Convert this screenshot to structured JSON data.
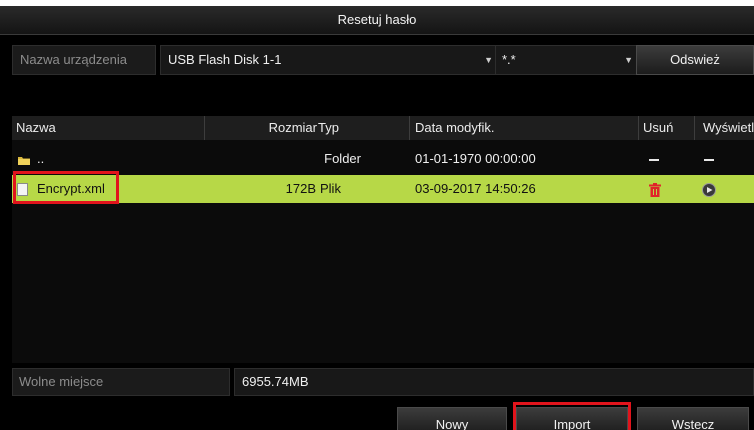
{
  "window": {
    "title": "Resetuj hasło"
  },
  "device": {
    "label": "Nazwa urządzenia",
    "value": "USB Flash Disk 1-1",
    "filter": "*.*",
    "refresh_label": "Odswież"
  },
  "table": {
    "headers": {
      "name": "Nazwa",
      "size": "Rozmiar",
      "type": "Typ",
      "modified": "Data modyfik.",
      "delete": "Usuń",
      "view": "Wyświetl"
    },
    "rows": [
      {
        "name": "..",
        "size": "",
        "type": "Folder",
        "modified": "01-01-1970 00:00:00",
        "icon": "folder-up-icon"
      },
      {
        "name": "Encrypt.xml",
        "size": "172B",
        "type": "Plik",
        "modified": "03-09-2017 14:50:26",
        "icon": "file-icon"
      }
    ]
  },
  "status": {
    "free_space_label": "Wolne miejsce",
    "free_space_value": "6955.74MB"
  },
  "buttons": {
    "new_label": "Nowy",
    "import_label": "Import",
    "back_label": "Wstecz"
  },
  "colors": {
    "selected_row": "#b7d847",
    "highlight_border": "#e1141c",
    "delete_icon": "#e0242a"
  }
}
